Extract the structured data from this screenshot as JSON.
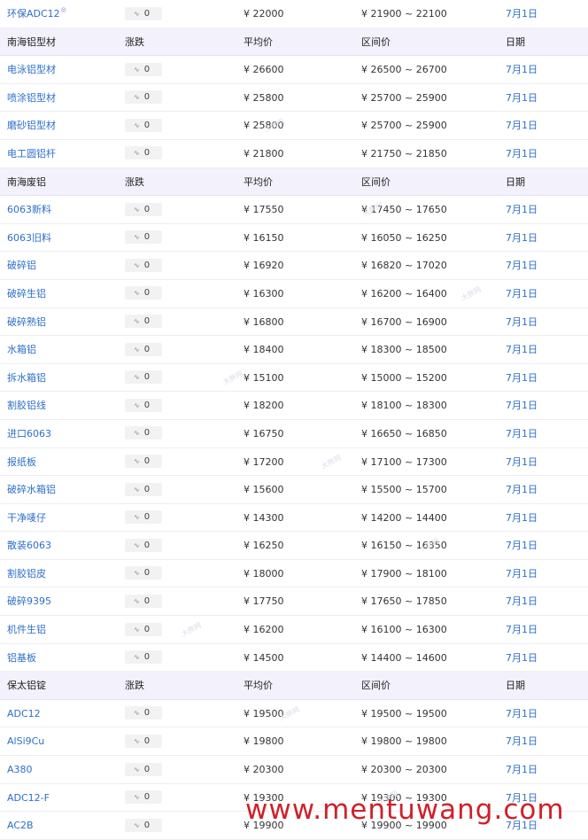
{
  "watermark": "www.mentuwang.com",
  "small_watermark": "大胖网",
  "rows": [
    {
      "type": "item",
      "name": "环保ADC12",
      "badge": true,
      "change": "0",
      "avg": "¥  22000",
      "range": "¥  21900 ~ 22100",
      "date": "7月1日"
    },
    {
      "type": "header",
      "name": "南海铝型材",
      "change": "涨跌",
      "avg": "平均价",
      "range": "区间价",
      "date": "日期"
    },
    {
      "type": "item",
      "name": "电泳铝型材",
      "change": "0",
      "avg": "¥  26600",
      "range": "¥  26500 ~ 26700",
      "date": "7月1日"
    },
    {
      "type": "item",
      "name": "喷涂铝型材",
      "change": "0",
      "avg": "¥  25800",
      "range": "¥  25700 ~ 25900",
      "date": "7月1日"
    },
    {
      "type": "item",
      "name": "磨砂铝型材",
      "change": "0",
      "avg": "¥  25800",
      "range": "¥  25700 ~ 25900",
      "date": "7月1日"
    },
    {
      "type": "item",
      "name": "电工圆铝杆",
      "change": "0",
      "avg": "¥  21800",
      "range": "¥  21750 ~ 21850",
      "date": "7月1日"
    },
    {
      "type": "header",
      "name": "南海废铝",
      "change": "涨跌",
      "avg": "平均价",
      "range": "区间价",
      "date": "日期"
    },
    {
      "type": "item",
      "name": "6063新料",
      "change": "0",
      "avg": "¥  17550",
      "range": "¥  17450 ~ 17650",
      "date": "7月1日"
    },
    {
      "type": "item",
      "name": "6063旧料",
      "change": "0",
      "avg": "¥  16150",
      "range": "¥  16050 ~ 16250",
      "date": "7月1日"
    },
    {
      "type": "item",
      "name": "破碎铝",
      "change": "0",
      "avg": "¥  16920",
      "range": "¥  16820 ~ 17020",
      "date": "7月1日"
    },
    {
      "type": "item",
      "name": "破碎生铝",
      "change": "0",
      "avg": "¥  16300",
      "range": "¥  16200 ~ 16400",
      "date": "7月1日"
    },
    {
      "type": "item",
      "name": "破碎熟铝",
      "change": "0",
      "avg": "¥  16800",
      "range": "¥  16700 ~ 16900",
      "date": "7月1日"
    },
    {
      "type": "item",
      "name": "水箱铝",
      "change": "0",
      "avg": "¥  18400",
      "range": "¥  18300 ~ 18500",
      "date": "7月1日"
    },
    {
      "type": "item",
      "name": "拆水箱铝",
      "change": "0",
      "avg": "¥  15100",
      "range": "¥  15000 ~ 15200",
      "date": "7月1日"
    },
    {
      "type": "item",
      "name": "割胶铝线",
      "change": "0",
      "avg": "¥  18200",
      "range": "¥  18100 ~ 18300",
      "date": "7月1日"
    },
    {
      "type": "item",
      "name": "进口6063",
      "change": "0",
      "avg": "¥  16750",
      "range": "¥  16650 ~ 16850",
      "date": "7月1日"
    },
    {
      "type": "item",
      "name": "报纸板",
      "change": "0",
      "avg": "¥  17200",
      "range": "¥  17100 ~ 17300",
      "date": "7月1日"
    },
    {
      "type": "item",
      "name": "破碎水箱铝",
      "change": "0",
      "avg": "¥  15600",
      "range": "¥  15500 ~ 15700",
      "date": "7月1日"
    },
    {
      "type": "item",
      "name": "干净唛仔",
      "change": "0",
      "avg": "¥  14300",
      "range": "¥  14200 ~ 14400",
      "date": "7月1日"
    },
    {
      "type": "item",
      "name": "散装6063",
      "change": "0",
      "avg": "¥  16250",
      "range": "¥  16150 ~ 16350",
      "date": "7月1日"
    },
    {
      "type": "item",
      "name": "割胶铝皮",
      "change": "0",
      "avg": "¥  18000",
      "range": "¥  17900 ~ 18100",
      "date": "7月1日"
    },
    {
      "type": "item",
      "name": "破碎9395",
      "change": "0",
      "avg": "¥  17750",
      "range": "¥  17650 ~ 17850",
      "date": "7月1日"
    },
    {
      "type": "item",
      "name": "机件生铝",
      "change": "0",
      "avg": "¥  16200",
      "range": "¥  16100 ~ 16300",
      "date": "7月1日"
    },
    {
      "type": "item",
      "name": "铝基板",
      "change": "0",
      "avg": "¥  14500",
      "range": "¥  14400 ~ 14600",
      "date": "7月1日"
    },
    {
      "type": "header",
      "name": "保太铝锭",
      "change": "涨跌",
      "avg": "平均价",
      "range": "区间价",
      "date": "日期"
    },
    {
      "type": "item",
      "name": "ADC12",
      "change": "0",
      "avg": "¥  19500",
      "range": "¥  19500 ~ 19500",
      "date": "7月1日"
    },
    {
      "type": "item",
      "name": "AlSi9Cu",
      "change": "0",
      "avg": "¥  19800",
      "range": "¥  19800 ~ 19800",
      "date": "7月1日"
    },
    {
      "type": "item",
      "name": "A380",
      "change": "0",
      "avg": "¥  20300",
      "range": "¥  20300 ~ 20300",
      "date": "7月1日"
    },
    {
      "type": "item",
      "name": "ADC12-F",
      "change": "0",
      "avg": "¥  19300",
      "range": "¥  19300 ~ 19300",
      "date": "7月1日"
    },
    {
      "type": "item",
      "name": "AC2B",
      "change": "0",
      "avg": "¥  19900",
      "range": "¥  19900 ~ 19900",
      "date": "7月1日"
    }
  ]
}
